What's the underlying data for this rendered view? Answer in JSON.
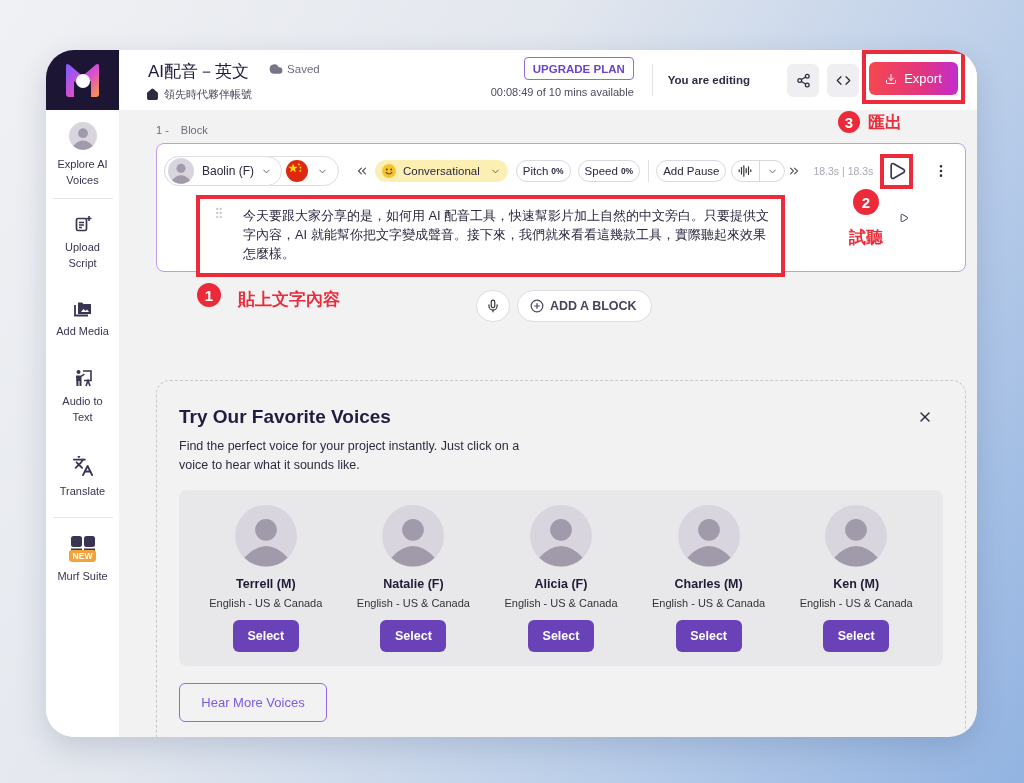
{
  "sidebar": {
    "sections": [
      {
        "items": [
          {
            "kind": "avatar",
            "label": "Explore AI Voices"
          }
        ]
      },
      {
        "items": [
          {
            "kind": "icon",
            "label": "Upload Script"
          },
          {
            "kind": "icon",
            "label": "Add Media"
          },
          {
            "kind": "icon",
            "label": "Audio to Text"
          },
          {
            "kind": "icon",
            "label": "Translate"
          }
        ]
      },
      {
        "items": [
          {
            "kind": "icon",
            "label": "Murf Suite",
            "badge": "NEW"
          }
        ]
      }
    ]
  },
  "header": {
    "title": "AI配音－英文",
    "save_status": "Saved",
    "workspace": "領先時代夥伴帳號",
    "upgrade_button": "UPGRADE PLAN",
    "usage": "00:08:49 of 10 mins available",
    "editing_status": "You are editing",
    "export_button": "Export",
    "export_annotation": {
      "number": "3",
      "label": "匯出"
    }
  },
  "blocks": [
    {
      "number": "1 -",
      "label": "Block",
      "voice": "Baolin (F)",
      "style": "Conversational",
      "pitch": {
        "label": "Pitch",
        "value": "0%"
      },
      "speed": {
        "label": "Speed",
        "value": "0%"
      },
      "pause_button": "Add Pause",
      "duration": "18.3s | 18.3s",
      "text": "今天要跟大家分享的是，如何用 AI 配音工具，快速幫影片加上自然的中文旁白。只要提供文字內容，AI 就能幫你把文字變成聲音。接下來，我們就來看看這幾款工具，實際聽起來效果怎麼樣。",
      "play_annotation": {
        "number": "2",
        "label": "試聽"
      },
      "text_annotation": {
        "number": "1",
        "label": "貼上文字內容"
      }
    }
  ],
  "add_block_button": "ADD A BLOCK",
  "favorite_voices": {
    "title": "Try Our Favorite Voices",
    "description": "Find the perfect voice for your project instantly. Just click on a voice to hear what it sounds like.",
    "voices": [
      {
        "name": "Terrell (M)",
        "language": "English - US & Canada",
        "button": "Select"
      },
      {
        "name": "Natalie (F)",
        "language": "English - US & Canada",
        "button": "Select"
      },
      {
        "name": "Alicia (F)",
        "language": "English - US & Canada",
        "button": "Select"
      },
      {
        "name": "Charles (M)",
        "language": "English - US & Canada",
        "button": "Select"
      },
      {
        "name": "Ken (M)",
        "language": "English - US & Canada",
        "button": "Select"
      }
    ],
    "more_button": "Hear More Voices"
  }
}
